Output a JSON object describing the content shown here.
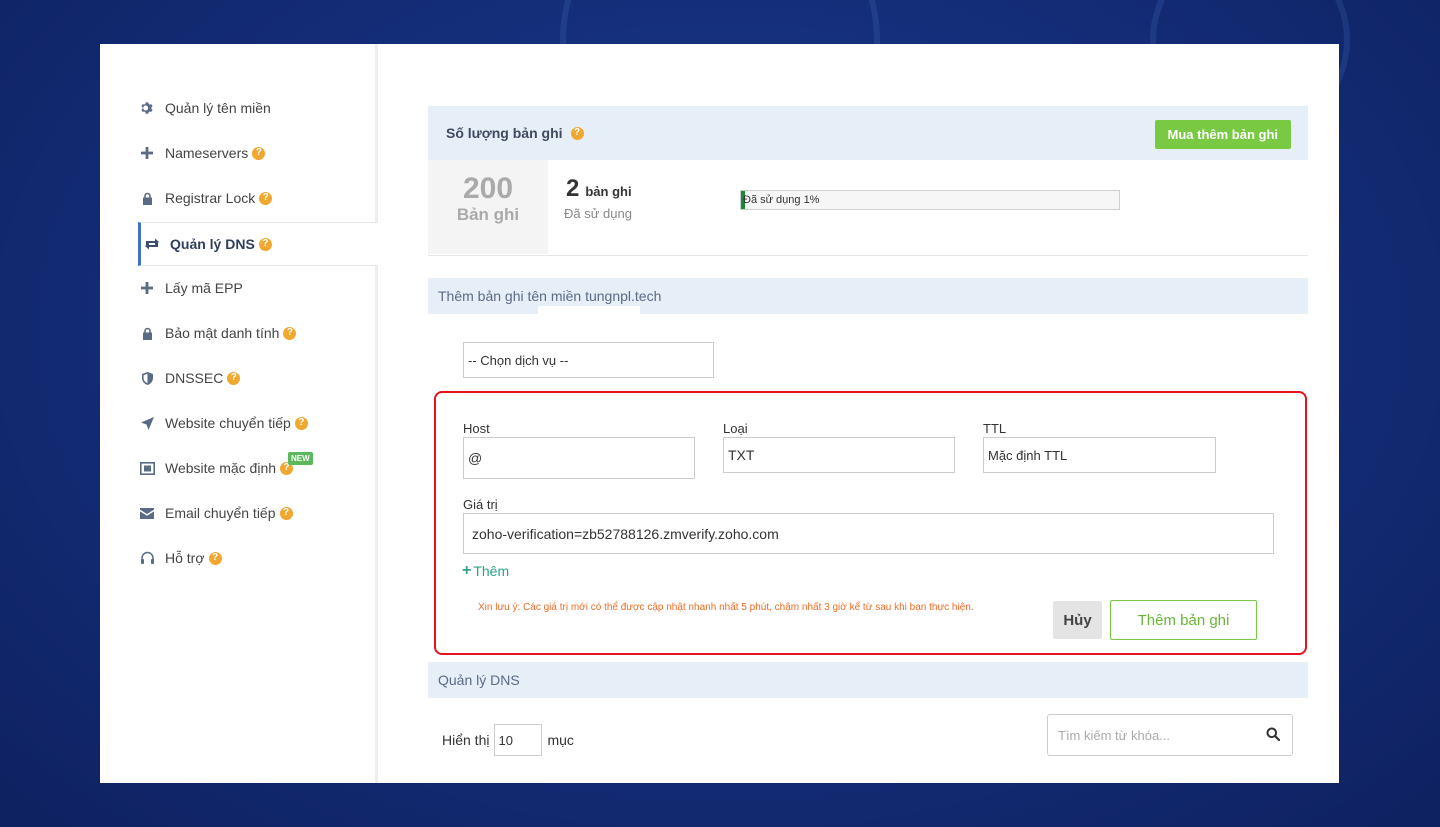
{
  "sidebar": {
    "items": [
      {
        "label": "Quản lý tên miền",
        "icon": "gear-icon",
        "help": false
      },
      {
        "label": "Nameservers",
        "icon": "plus-icon",
        "help": true
      },
      {
        "label": "Registrar Lock",
        "icon": "lock-icon",
        "help": true
      },
      {
        "label": "Quản lý DNS",
        "icon": "sync-icon",
        "help": true,
        "active": true
      },
      {
        "label": "Lấy mã EPP",
        "icon": "plus-icon",
        "help": false
      },
      {
        "label": "Bảo mật danh tính",
        "icon": "lock-icon",
        "help": true
      },
      {
        "label": "DNSSEC",
        "icon": "shield-icon",
        "help": true
      },
      {
        "label": "Website chuyển tiếp",
        "icon": "send-icon",
        "help": true
      },
      {
        "label": "Website mặc định",
        "icon": "frame-icon",
        "help": true,
        "badge": "NEW"
      },
      {
        "label": "Email chuyển tiếp",
        "icon": "envelope-icon",
        "help": true
      },
      {
        "label": "Hỗ trợ",
        "icon": "headset-icon",
        "help": true
      }
    ],
    "help_glyph": "?"
  },
  "records": {
    "header_title": "Số lượng bản ghi",
    "buy_more_label": "Mua thêm bản ghi",
    "total_number": "200",
    "total_label": "Bản ghi",
    "used_number": "2",
    "used_unit": "bản ghi",
    "used_label": "Đã sử dụng",
    "progress_text": "Đã sử dụng 1%",
    "progress_percent": 1
  },
  "add_record": {
    "section_title": "Thêm bản ghi tên miền tungnpl.tech",
    "service_select": "-- Chọn dịch vụ --",
    "host_label": "Host",
    "host_value": "@",
    "type_label": "Loại",
    "type_value": "TXT",
    "ttl_label": "TTL",
    "ttl_value": "Mặc định TTL",
    "value_label": "Giá trị",
    "value_value": "zoho-verification=zb52788126.zmverify.zoho.com",
    "add_more_label": "Thêm",
    "add_more_glyph": "+",
    "note": "Xin lưu ý: Các giá trị mới có thể được cập nhật nhanh nhất 5 phút, chậm nhất 3 giờ kể từ sau khi bạn thực hiện.",
    "cancel_label": "Hủy",
    "submit_label": "Thêm bản ghi"
  },
  "dns_manage": {
    "section_title": "Quản lý DNS",
    "show_label": "Hiển thị",
    "show_value": "10",
    "show_suffix": "mục",
    "search_placeholder": "Tìm kiếm từ khóa..."
  },
  "colors": {
    "accent_green": "#7ac943",
    "highlight_red": "#e3121b",
    "help_orange": "#f0a830",
    "note_orange": "#ef6c24",
    "header_bg": "#e6eef8"
  }
}
